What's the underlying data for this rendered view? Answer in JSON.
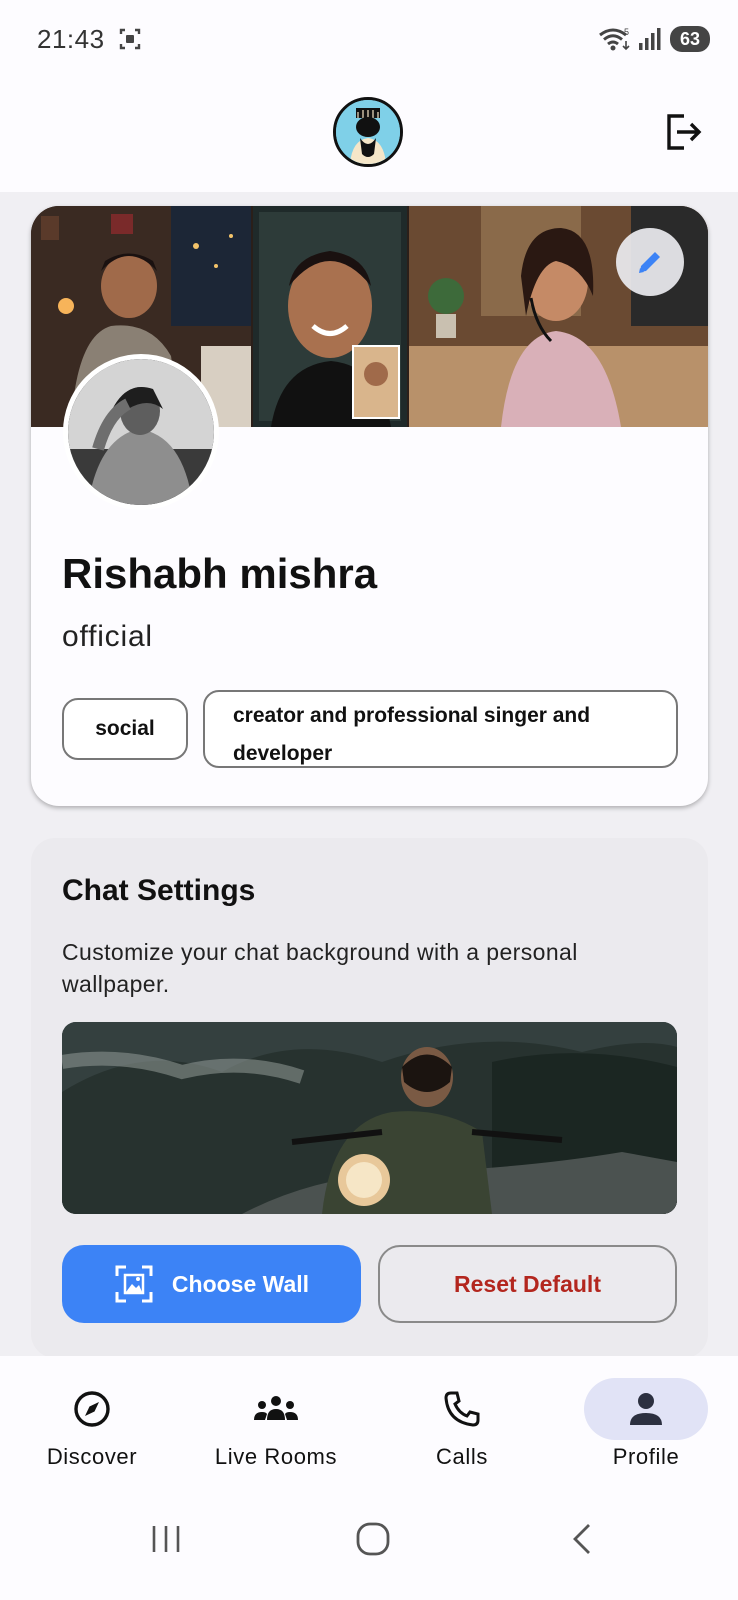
{
  "status_bar": {
    "time": "21:43",
    "battery": "63",
    "icons": [
      "screenshot-icon",
      "wifi-icon",
      "signal-icon",
      "battery-icon"
    ]
  },
  "header": {
    "avatar_icon": "app-avatar",
    "logout_icon": "logout-icon"
  },
  "profile": {
    "name": "Rishabh mishra",
    "subtitle": "official",
    "tags": [
      "social",
      "creator and professional singer  and developer"
    ],
    "edit_icon": "pencil-icon"
  },
  "chat_settings": {
    "title": "Chat Settings",
    "description": "Customize your chat background with a personal wallpaper.",
    "choose_label": "Choose Wall",
    "reset_label": "Reset Default",
    "colors": {
      "primary": "#3c83f6",
      "danger": "#b3261e"
    }
  },
  "bottom_nav": {
    "items": [
      {
        "label": "Discover",
        "icon": "compass-icon"
      },
      {
        "label": "Live Rooms",
        "icon": "group-icon"
      },
      {
        "label": "Calls",
        "icon": "phone-icon"
      },
      {
        "label": "Profile",
        "icon": "person-icon"
      }
    ],
    "active": "Profile"
  },
  "system_nav": [
    "recents-icon",
    "home-icon",
    "back-icon"
  ]
}
